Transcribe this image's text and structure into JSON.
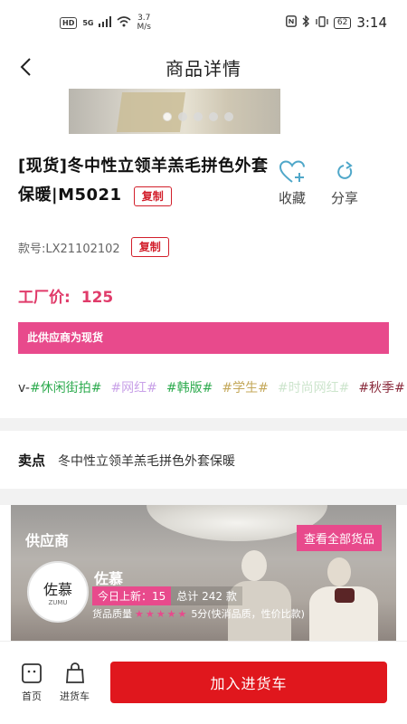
{
  "status_bar": {
    "hd": "HD",
    "network": "5G",
    "speed_value": "3.7",
    "speed_unit": "M/s",
    "battery": "62",
    "time": "3:14"
  },
  "nav": {
    "title": "商品详情",
    "back_icon": "chevron-left-icon"
  },
  "carousel": {
    "count": 5,
    "active_index": 0
  },
  "product": {
    "title": "[现货]冬中性立领羊羔毛拼色外套保暖|M5021",
    "copy_label": "复制",
    "sku_label": "款号:LX21102102",
    "sku_copy_label": "复制",
    "price_label": "工厂价:",
    "price_value": "125"
  },
  "actions": {
    "favorite_label": "收藏",
    "share_label": "分享"
  },
  "banner": {
    "text": "此供应商为现货"
  },
  "tags": {
    "prefix": "v-",
    "items": [
      {
        "text": "#休闲街拍#",
        "color": "#2eab4f"
      },
      {
        "text": "#网红#",
        "color": "#c9a2e8"
      },
      {
        "text": "#韩版#",
        "color": "#2eab4f"
      },
      {
        "text": "#学生#",
        "color": "#c4a85a"
      },
      {
        "text": "#时尚网红#",
        "color": "#cde5cd"
      },
      {
        "text": "#秋季#",
        "color": "#8a2b3c"
      }
    ]
  },
  "selling_point": {
    "label": "卖点",
    "text": "冬中性立领羊羔毛拼色外套保暖"
  },
  "supplier": {
    "section_label": "供应商",
    "all_goods_label": "查看全部货品",
    "logo_text": "佐慕",
    "logo_sub": "ZUMU",
    "shop_name": "佐慕",
    "today_new": "今日上新：15",
    "total": "总计 242 款",
    "quality_label": "货品质量",
    "stars": "★★★★★",
    "quality_score": "5分(快消品质，性价比款)"
  },
  "bottom_bar": {
    "home_label": "首页",
    "cart_label": "进货车",
    "add_to_cart_label": "加入进货车"
  },
  "colors": {
    "accent_red": "#e0171d",
    "price_pink": "#e03b6a",
    "banner_pink": "#e84a8c",
    "favorite_icon": "#4fa7c9"
  }
}
